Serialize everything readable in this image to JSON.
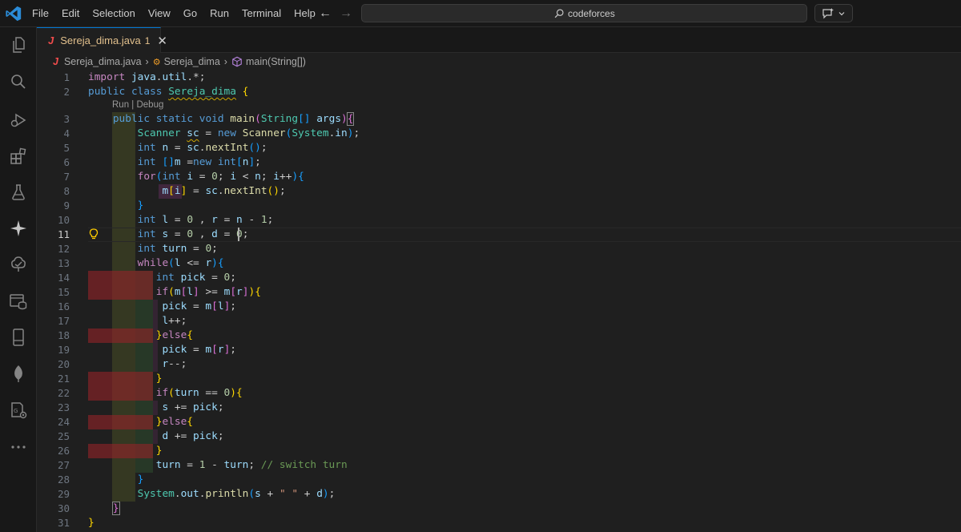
{
  "menu": [
    "File",
    "Edit",
    "Selection",
    "View",
    "Go",
    "Run",
    "Terminal",
    "Help"
  ],
  "search": {
    "text": "codeforces"
  },
  "tab": {
    "filename": "Sereja_dima.java",
    "problems": "1",
    "close": "✕"
  },
  "breadcrumb": {
    "file": "Sereja_dima.java",
    "class": "Sereja_dima",
    "method": "main(String[])"
  },
  "codelens": "Run | Debug",
  "line_numbers": [
    "1",
    "2",
    "3",
    "4",
    "5",
    "6",
    "7",
    "8",
    "9",
    "10",
    "11",
    "12",
    "13",
    "14",
    "15",
    "16",
    "17",
    "18",
    "19",
    "20",
    "21",
    "22",
    "23",
    "24",
    "25",
    "26",
    "27",
    "28",
    "29",
    "30",
    "31"
  ],
  "active_line": "11",
  "code_lines": [
    "import java.util.*;",
    "public class Sereja_dima {",
    "    public static void main(String[] args){",
    "        Scanner sc = new Scanner(System.in);",
    "        int n = sc.nextInt();",
    "        int []m =new int[n];",
    "        for(int i = 0; i < n; i++){",
    "            m[i] = sc.nextInt();",
    "        }",
    "        int l = 0 , r = n - 1;",
    "        int s = 0 , d = 0;",
    "        int turn = 0;",
    "        while(l <= r){",
    "           int pick = 0;",
    "           if(m[l] >= m[r]){",
    "            pick = m[l];",
    "            l++;",
    "           }else{",
    "            pick = m[r];",
    "            r--;",
    "           }",
    "           if(turn == 0){",
    "            s += pick;",
    "           }else{",
    "            d += pick;",
    "           }",
    "           turn = 1 - turn; // switch turn",
    "        }",
    "        System.out.println(s + \" \" + d);",
    "    }",
    "}"
  ],
  "colors": {
    "accent": "#0078d4",
    "editor_bg": "#1f1f1f",
    "titlebar_bg": "#181818",
    "java_icon": "#f14c4c",
    "modified_tab": "#e2c08d"
  },
  "activity_icons": [
    "explorer-icon",
    "search-icon",
    "run-debug-icon",
    "extensions-icon",
    "testing-icon",
    "copilot-icon",
    "remote-explorer-icon",
    "database-icon",
    "phone-icon",
    "mongodb-icon",
    "sql-icon",
    "more-icon"
  ]
}
